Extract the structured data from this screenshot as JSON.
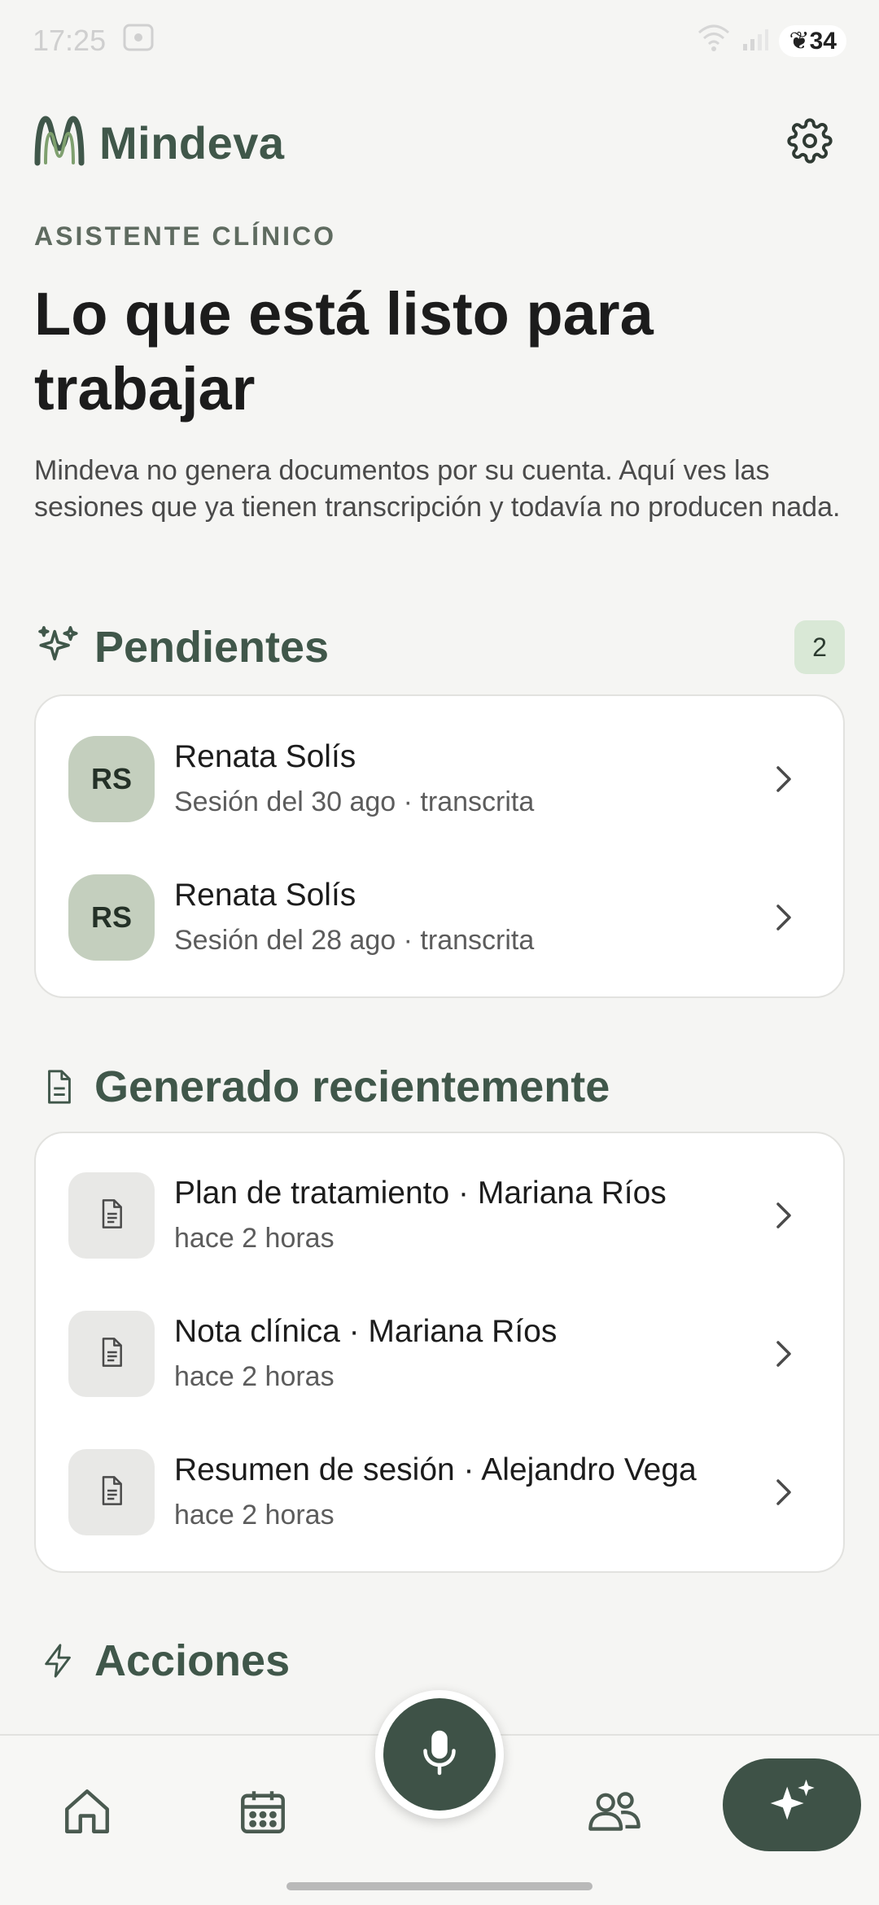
{
  "status_bar": {
    "time": "17:25",
    "battery": "34"
  },
  "header": {
    "app_name": "Mindeva",
    "settings_icon": "gear-icon"
  },
  "eyebrow": "ASISTENTE CLÍNICO",
  "headline": "Lo que está listo para trabajar",
  "intro": "Mindeva no genera documentos por su cuenta. Aquí ves las sesiones que ya tienen transcripción y todavía no producen nada.",
  "pending": {
    "title": "Pendientes",
    "icon": "sparkles-icon",
    "count": "2",
    "items": [
      {
        "initials": "RS",
        "name": "Renata Solís",
        "subtitle": "Sesión del 30 ago · transcrita"
      },
      {
        "initials": "RS",
        "name": "Renata Solís",
        "subtitle": "Sesión del 28 ago · transcrita"
      }
    ]
  },
  "recent": {
    "title": "Generado recientemente",
    "icon": "document-icon",
    "items": [
      {
        "title": "Plan de tratamiento · Mariana Ríos",
        "subtitle": "hace 2 horas"
      },
      {
        "title": "Nota clínica · Mariana Ríos",
        "subtitle": "hace 2 horas"
      },
      {
        "title": "Resumen de sesión · Alejandro Vega",
        "subtitle": "hace 2 horas"
      }
    ]
  },
  "actions": {
    "title": "Acciones",
    "icon": "bolt-icon"
  },
  "nav": {
    "items": [
      "home-icon",
      "calendar-icon",
      "microphone-icon",
      "patients-icon",
      "sparkles-icon"
    ]
  },
  "colors": {
    "brand": "#40574a",
    "accent_dark": "#3e5247",
    "badge_bg": "#d9e8d6",
    "avatar_bg": "#c4cfbe"
  }
}
